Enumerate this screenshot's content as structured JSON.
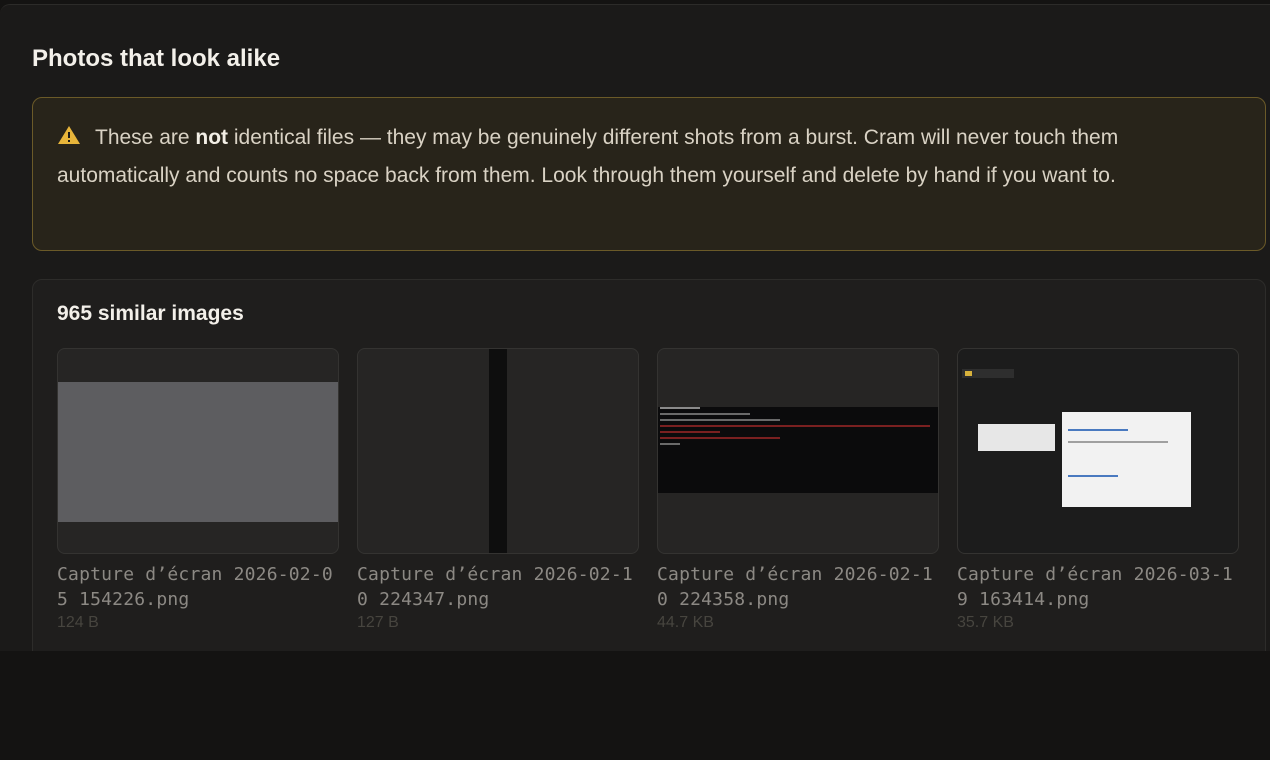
{
  "page": {
    "title": "Photos that look alike"
  },
  "warning": {
    "icon": "warning-triangle-icon",
    "text_before": "These are ",
    "text_bold": "not",
    "text_after": " identical files — they may be genuinely different shots from a burst. Cram will never touch them automatically and counts no space back from them. Look through them yourself and delete by hand if you want to.",
    "accent_color": "#e8b53a"
  },
  "group": {
    "title": "965 similar images",
    "items": [
      {
        "name": "Capture d’écran 2026-02-05 154226.png",
        "size": "124 B"
      },
      {
        "name": "Capture d’écran 2026-02-10 224347.png",
        "size": "127 B"
      },
      {
        "name": "Capture d’écran 2026-02-10 224358.png",
        "size": "44.7 KB"
      },
      {
        "name": "Capture d’écran 2026-03-19 163414.png",
        "size": "35.7 KB"
      }
    ]
  }
}
